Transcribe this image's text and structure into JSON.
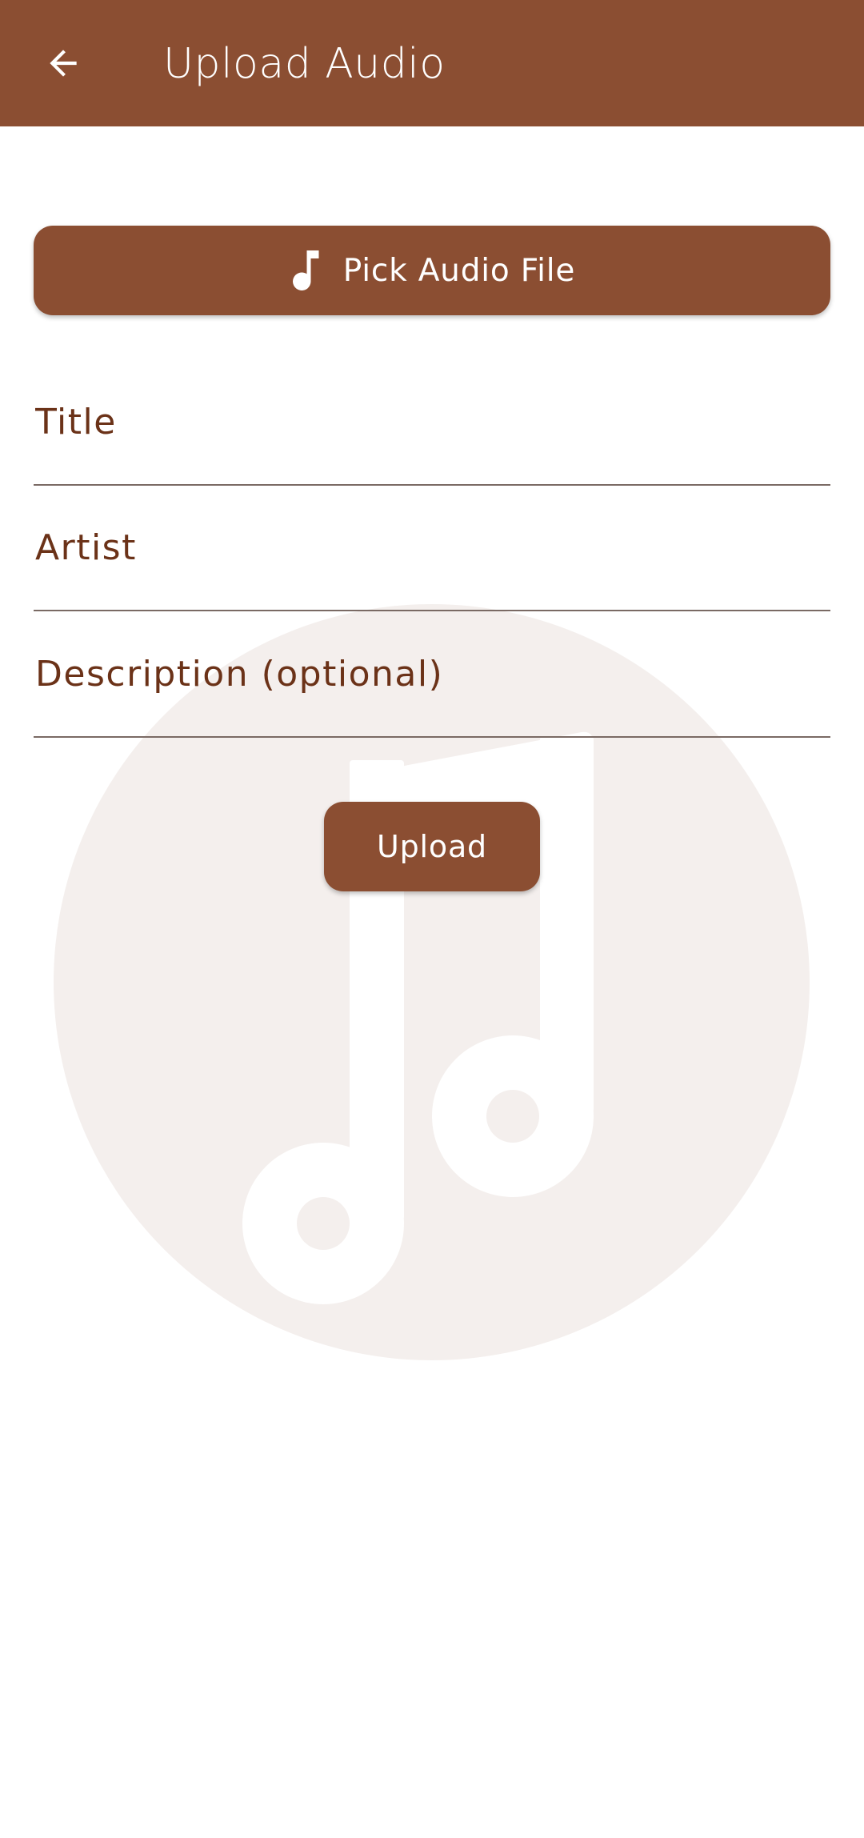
{
  "app_bar": {
    "title": "Upload Audio",
    "back_icon": "arrow-back-icon",
    "background": "#8b4e32"
  },
  "pick_button": {
    "label": "Pick Audio File",
    "icon": "music-note-icon"
  },
  "fields": {
    "title": {
      "placeholder": "Title",
      "value": ""
    },
    "artist": {
      "placeholder": "Artist",
      "value": ""
    },
    "description": {
      "placeholder": "Description (optional)",
      "value": ""
    }
  },
  "upload_button": {
    "label": "Upload"
  },
  "watermark": {
    "icon": "music-notes-icon",
    "circle_color": "#f4efed"
  },
  "colors": {
    "primary": "#8b4e32",
    "label_text": "#6b3218",
    "underline": "#7a6a64"
  }
}
